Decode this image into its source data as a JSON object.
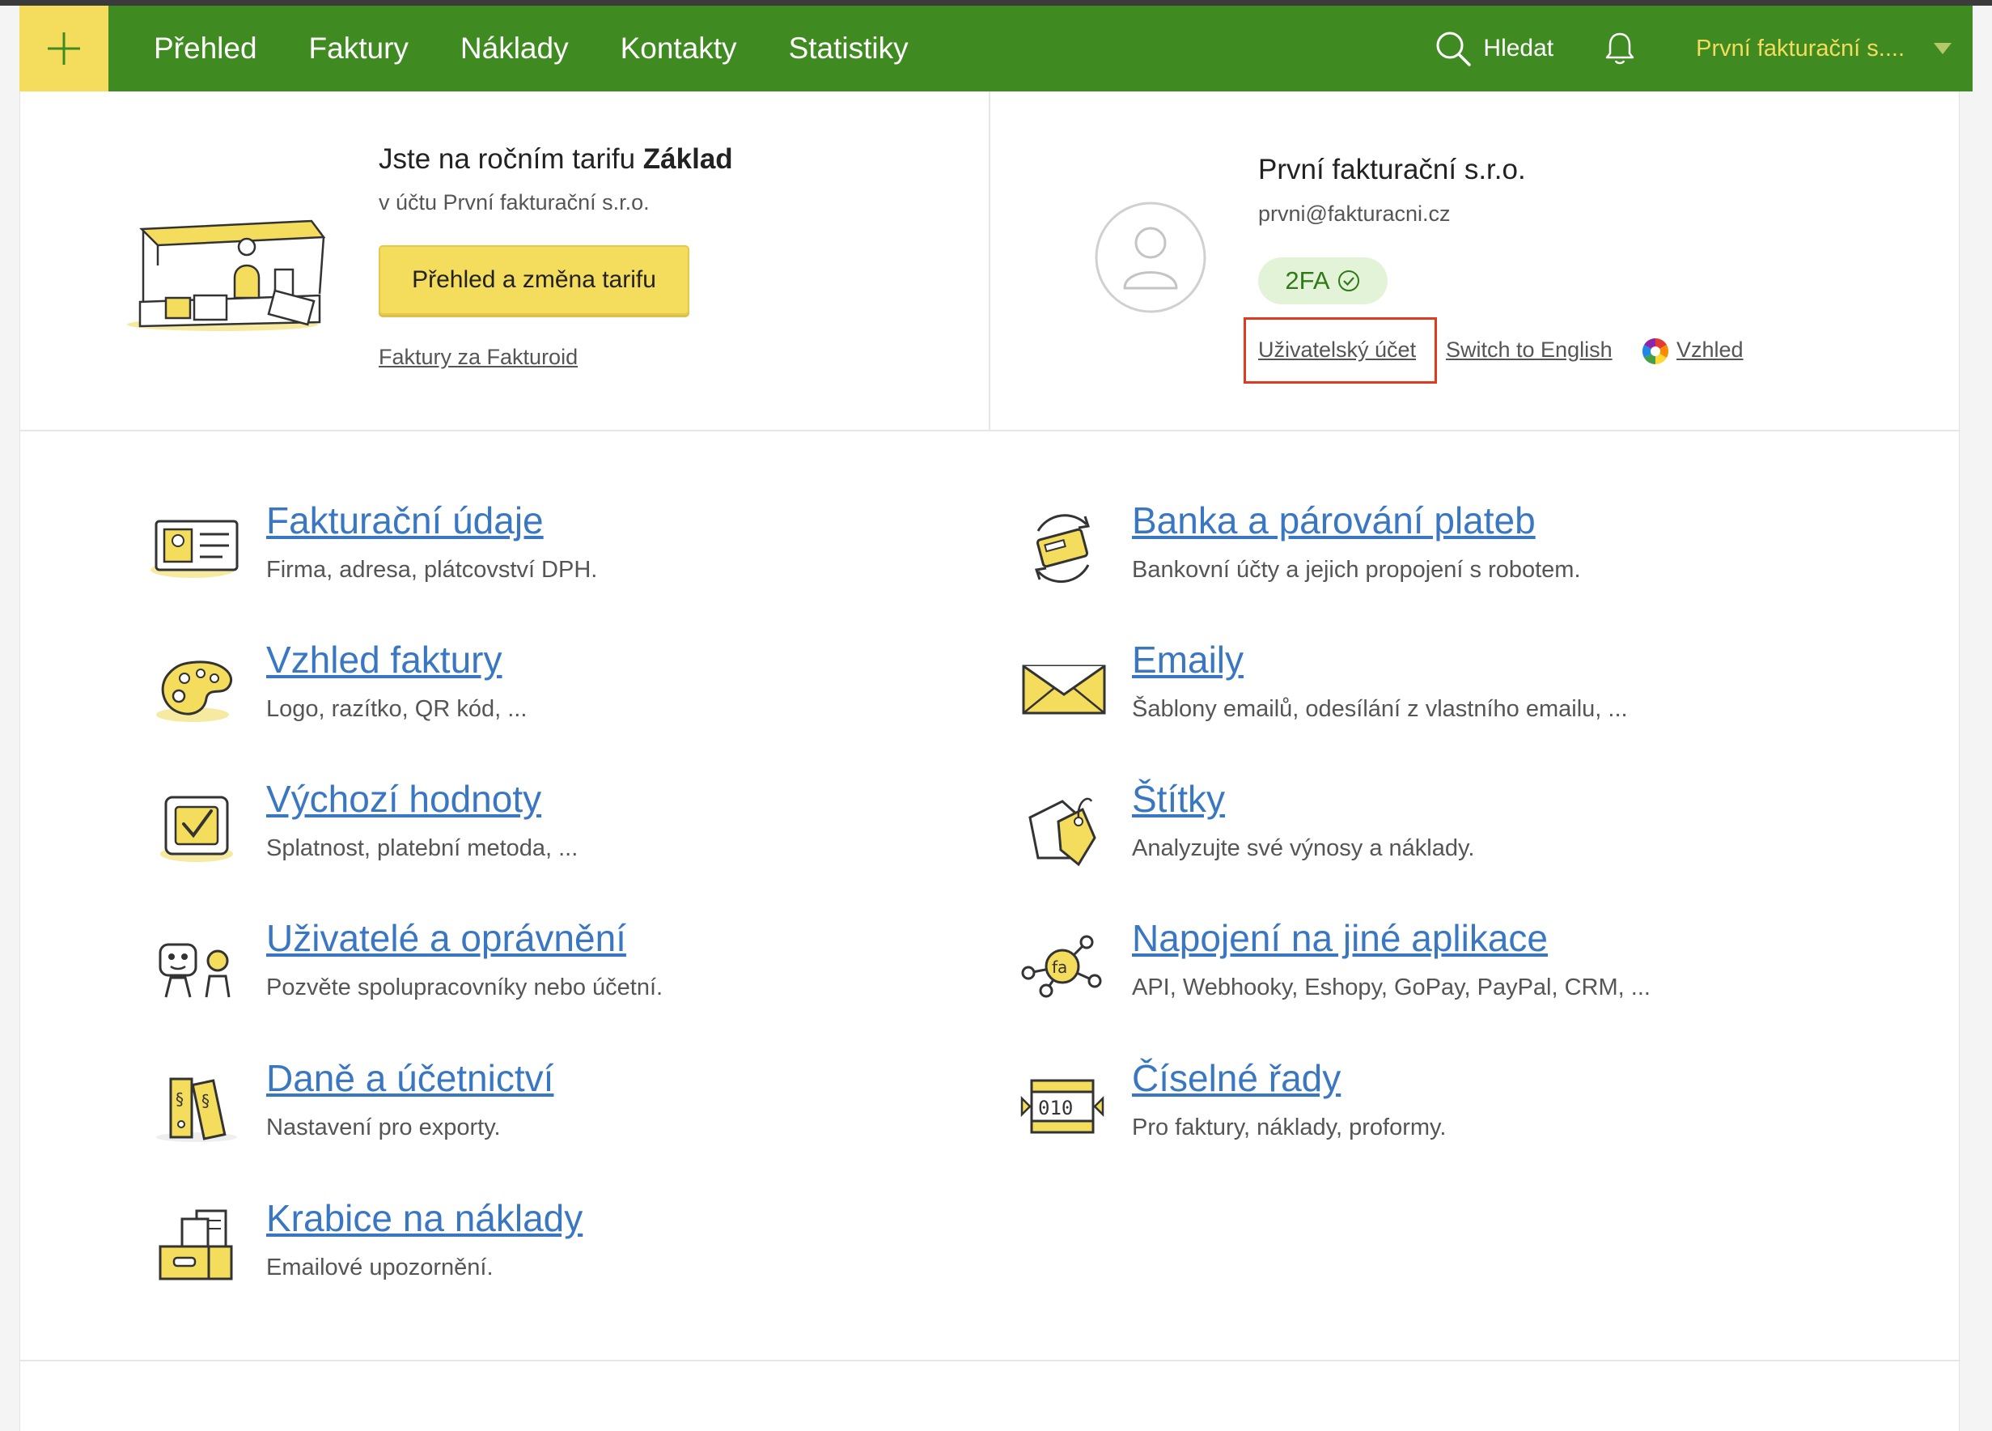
{
  "nav": {
    "add_button_icon": "plus-icon",
    "items": [
      {
        "label": "Přehled"
      },
      {
        "label": "Faktury"
      },
      {
        "label": "Náklady"
      },
      {
        "label": "Kontakty"
      },
      {
        "label": "Statistiky"
      }
    ],
    "search_label": "Hledat",
    "account_name": "První fakturační s...."
  },
  "tariff": {
    "title_prefix": "Jste na ročním tarifu ",
    "title_plan": "Základ",
    "subtitle": "v účtu První fakturační s.r.o.",
    "button_label": "Přehled a změna tarifu",
    "invoices_link": "Faktury za Fakturoid"
  },
  "profile": {
    "name": "První fakturační s.r.o.",
    "email": "prvni@fakturacni.cz",
    "tfa_label": "2FA",
    "user_account_link": "Uživatelský účet",
    "language_link": "Switch to English",
    "appearance_link": "Vzhled"
  },
  "settings": {
    "left": [
      {
        "title": "Fakturační údaje",
        "desc": "Firma, adresa, plátcovství DPH.",
        "icon": "id-card-icon"
      },
      {
        "title": "Vzhled faktury",
        "desc": "Logo, razítko, QR kód, ...",
        "icon": "palette-icon"
      },
      {
        "title": "Výchozí hodnoty",
        "desc": "Splatnost, platební metoda, ...",
        "icon": "checkbox-icon"
      },
      {
        "title": "Uživatelé a oprávnění",
        "desc": "Pozvěte spolupracovníky nebo účetní.",
        "icon": "users-icon"
      },
      {
        "title": "Daně a účetnictví",
        "desc": "Nastavení pro exporty.",
        "icon": "binders-icon"
      },
      {
        "title": "Krabice na náklady",
        "desc": "Emailové upozornění.",
        "icon": "box-icon"
      }
    ],
    "right": [
      {
        "title": "Banka a párování plateb",
        "desc": "Bankovní účty a jejich propojení s robotem.",
        "icon": "bank-card-icon"
      },
      {
        "title": "Emaily",
        "desc": "Šablony emailů, odesílání z vlastního emailu, ...",
        "icon": "envelope-icon"
      },
      {
        "title": "Štítky",
        "desc": "Analyzujte své výnosy a náklady.",
        "icon": "tags-icon"
      },
      {
        "title": "Napojení na jiné aplikace",
        "desc": "API, Webhooky, Eshopy, GoPay, PayPal, CRM, ...",
        "icon": "integration-icon"
      },
      {
        "title": "Číselné řady",
        "desc": "Pro faktury, náklady, proformy.",
        "icon": "number-series-icon"
      }
    ]
  },
  "colors": {
    "nav_green": "#3f8b22",
    "accent_yellow": "#f4dc5c",
    "link_blue": "#3a77c2",
    "highlight_red": "#e03b1f"
  }
}
